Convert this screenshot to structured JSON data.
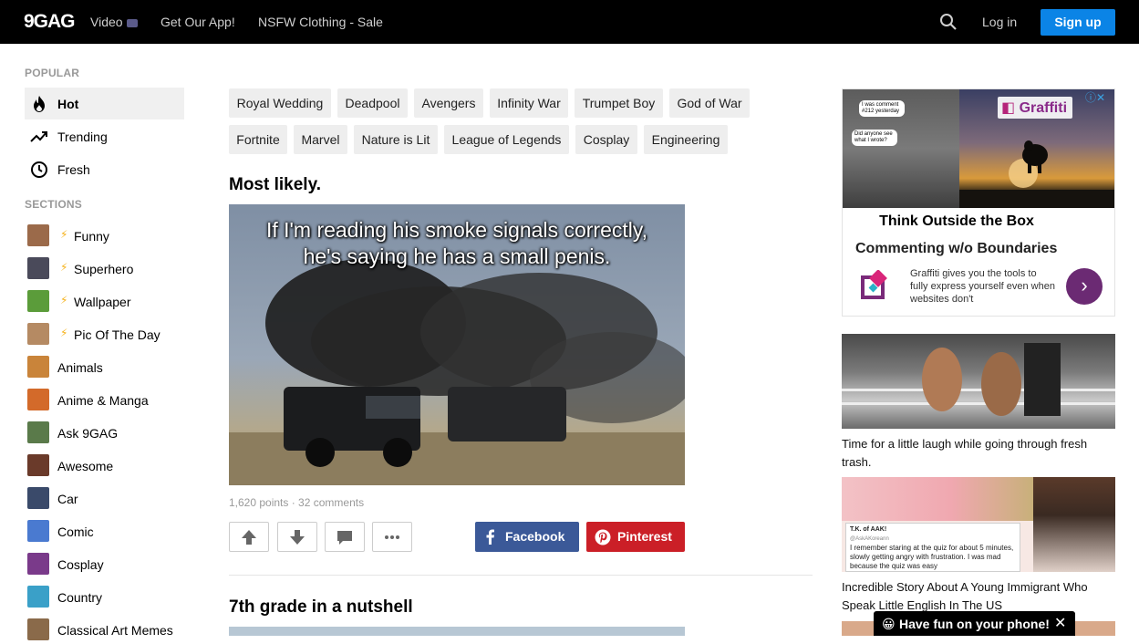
{
  "header": {
    "logo": "9GAG",
    "nav": [
      "Video",
      "Get Our App!",
      "NSFW Clothing - Sale"
    ],
    "login": "Log in",
    "signup": "Sign up"
  },
  "sidebar": {
    "popular_heading": "POPULAR",
    "popular": [
      {
        "label": "Hot",
        "icon": "flame-icon"
      },
      {
        "label": "Trending",
        "icon": "trending-icon"
      },
      {
        "label": "Fresh",
        "icon": "clock-icon"
      }
    ],
    "sections_heading": "SECTIONS",
    "sections": [
      {
        "label": "Funny",
        "featured": true,
        "color": "#9b6a4a"
      },
      {
        "label": "Superhero",
        "featured": true,
        "color": "#4a4a5a"
      },
      {
        "label": "Wallpaper",
        "featured": true,
        "color": "#5b9c3a"
      },
      {
        "label": "Pic Of The Day",
        "featured": true,
        "color": "#b58a63"
      },
      {
        "label": "Animals",
        "featured": false,
        "color": "#c9843a"
      },
      {
        "label": "Anime & Manga",
        "featured": false,
        "color": "#d36a2a"
      },
      {
        "label": "Ask 9GAG",
        "featured": false,
        "color": "#5a7a4a"
      },
      {
        "label": "Awesome",
        "featured": false,
        "color": "#6a3a2a"
      },
      {
        "label": "Car",
        "featured": false,
        "color": "#3a4a6a"
      },
      {
        "label": "Comic",
        "featured": false,
        "color": "#4a7ad0"
      },
      {
        "label": "Cosplay",
        "featured": false,
        "color": "#7a3a8a"
      },
      {
        "label": "Country",
        "featured": false,
        "color": "#3aa0c8"
      },
      {
        "label": "Classical Art Memes",
        "featured": false,
        "color": "#8a6a4a"
      }
    ]
  },
  "tags": {
    "row1": [
      "Royal Wedding",
      "Deadpool",
      "Avengers",
      "Infinity War",
      "Trumpet Boy",
      "God of War"
    ],
    "row2": [
      "Fortnite",
      "Marvel",
      "Nature is Lit",
      "League of Legends",
      "Cosplay",
      "Engineering"
    ]
  },
  "post1": {
    "title": "Most likely.",
    "caption_line1": "If I'm reading his smoke signals correctly,",
    "caption_line2": "he's saying he has a small penis.",
    "meta": "1,620 points · 32 comments",
    "facebook": "Facebook",
    "pinterest": "Pinterest"
  },
  "post2": {
    "title": "7th grade in a nutshell"
  },
  "ad": {
    "brand": "Graffiti",
    "bubble1": "I was comment #212 yesterday",
    "bubble2": "Did anyone see what I wrote?",
    "headline1": "Think Outside the Box",
    "headline2": "Commenting w/o Boundaries",
    "description": "Graffiti gives you the tools to fully express yourself even when websites don't",
    "arrow": "›"
  },
  "right": {
    "caption1": "Time for a little laugh while going through fresh trash.",
    "tweet_name": "T.K. of AAK!",
    "tweet_handle": "@AskAKoreann",
    "tweet_text": "I remember staring at the quiz for about 5 minutes, slowly getting angry with frustration. I was mad because the quiz was easy",
    "caption2": "Incredible Story About A Young Immigrant Who Speak Little English In The US"
  },
  "mobile_banner": "Have fun on your phone!",
  "colors": {
    "signup": "#0b84e6",
    "facebook": "#3b5998",
    "pinterest": "#cb1f27"
  }
}
